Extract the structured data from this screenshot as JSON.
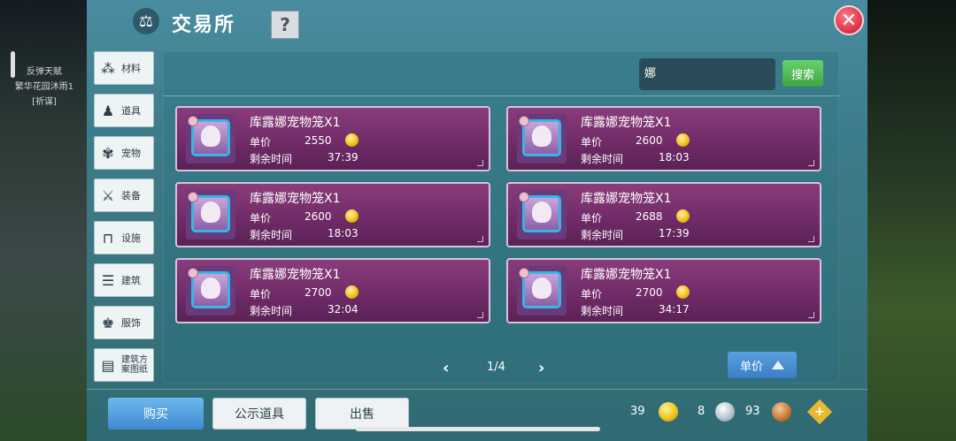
{
  "hud": {
    "line1": "反弹天赋",
    "line2": "繁华花园沐雨1",
    "line3": "[祈谋]"
  },
  "window": {
    "title": "交易所",
    "help": "?",
    "close": "✕"
  },
  "categories": [
    {
      "label": "材料",
      "icon": "material-icon"
    },
    {
      "label": "道具",
      "icon": "item-icon"
    },
    {
      "label": "宠物",
      "icon": "pet-icon"
    },
    {
      "label": "装备",
      "icon": "equipment-icon"
    },
    {
      "label": "设施",
      "icon": "facility-icon"
    },
    {
      "label": "建筑",
      "icon": "building-icon"
    },
    {
      "label": "服饰",
      "icon": "clothing-icon"
    },
    {
      "label": "建筑方\n案图纸",
      "icon": "blueprint-icon"
    }
  ],
  "search": {
    "value": "娜",
    "button": "搜索"
  },
  "listings": [
    {
      "name": "库露娜宠物笼X1",
      "price_label": "单价",
      "price": "2550",
      "time_label": "剩余时间",
      "time": "37:39"
    },
    {
      "name": "库露娜宠物笼X1",
      "price_label": "单价",
      "price": "2600",
      "time_label": "剩余时间",
      "time": "18:03"
    },
    {
      "name": "库露娜宠物笼X1",
      "price_label": "单价",
      "price": "2600",
      "time_label": "剩余时间",
      "time": "18:03"
    },
    {
      "name": "库露娜宠物笼X1",
      "price_label": "单价",
      "price": "2688",
      "time_label": "剩余时间",
      "time": "17:39"
    },
    {
      "name": "库露娜宠物笼X1",
      "price_label": "单价",
      "price": "2700",
      "time_label": "剩余时间",
      "time": "32:04"
    },
    {
      "name": "库露娜宠物笼X1",
      "price_label": "单价",
      "price": "2700",
      "time_label": "剩余时间",
      "time": "34:17"
    }
  ],
  "pager": {
    "text": "1/4",
    "prev": "‹",
    "next": "›"
  },
  "sort": {
    "label": "单价"
  },
  "tabs": {
    "buy": "购买",
    "public": "公示道具",
    "sell": "出售"
  },
  "currency": {
    "gold": "39",
    "silver": "8",
    "bronze": "93",
    "add": "+"
  },
  "colors": {
    "panel": "#3d7c8c",
    "listing": "#7a3370",
    "accent": "#3f8ad0",
    "search_button": "#4bb552"
  }
}
